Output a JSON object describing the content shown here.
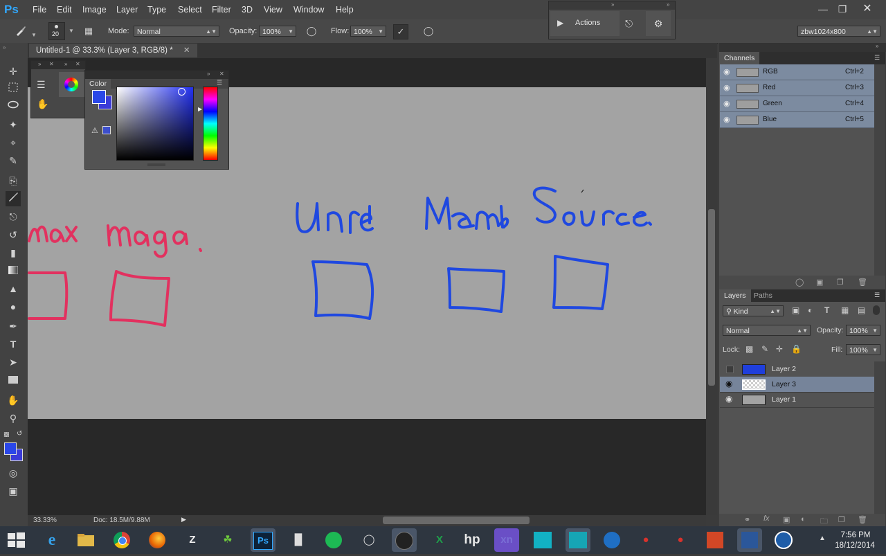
{
  "app": {
    "logo": "Ps"
  },
  "menu": [
    "File",
    "Edit",
    "Image",
    "Layer",
    "Type",
    "Select",
    "Filter",
    "3D",
    "View",
    "Window",
    "Help"
  ],
  "options": {
    "brush_size": "20",
    "mode_label": "Mode:",
    "mode_value": "Normal",
    "opacity_label": "Opacity:",
    "opacity_value": "100%",
    "flow_label": "Flow:",
    "flow_value": "100%"
  },
  "actions_panel": {
    "label": "Actions"
  },
  "workspace": "zbw1024x800",
  "document": {
    "tab_title": "Untitled-1 @ 33.3% (Layer 3, RGB/8) *",
    "zoom": "33.33%",
    "doc_info": "Doc: 18.5M/9.88M"
  },
  "canvas_drawing": {
    "words": [
      "max",
      "maya.",
      "Unreal",
      "Marmoset",
      "Source."
    ],
    "colors": {
      "pink": "#e2315f",
      "blue": "#1f48e0",
      "canvas": "#a3a3a3"
    }
  },
  "color_panel": {
    "title": "Color",
    "foreground": "#2a47e8",
    "background": "#3b3bd8"
  },
  "channels": {
    "tab": "Channels",
    "rows": [
      {
        "name": "RGB",
        "shortcut": "Ctrl+2"
      },
      {
        "name": "Red",
        "shortcut": "Ctrl+3"
      },
      {
        "name": "Green",
        "shortcut": "Ctrl+4"
      },
      {
        "name": "Blue",
        "shortcut": "Ctrl+5"
      }
    ]
  },
  "layers": {
    "tabs": [
      "Layers",
      "Paths"
    ],
    "kind_label": "Kind",
    "blend": "Normal",
    "opacity_label": "Opacity:",
    "opacity_value": "100%",
    "lock_label": "Lock:",
    "fill_label": "Fill:",
    "fill_value": "100%",
    "rows": [
      {
        "name": "Layer 2",
        "visible": false,
        "selected": false,
        "thumb": "#1f3fdc"
      },
      {
        "name": "Layer 3",
        "visible": true,
        "selected": true,
        "thumb": "checker"
      },
      {
        "name": "Layer 1",
        "visible": true,
        "selected": false,
        "thumb": "#a3a3a3"
      }
    ]
  },
  "taskbar": {
    "time": "7:56 PM",
    "date": "18/12/2014",
    "apps": [
      "hp",
      "xn",
      "Ps"
    ]
  }
}
